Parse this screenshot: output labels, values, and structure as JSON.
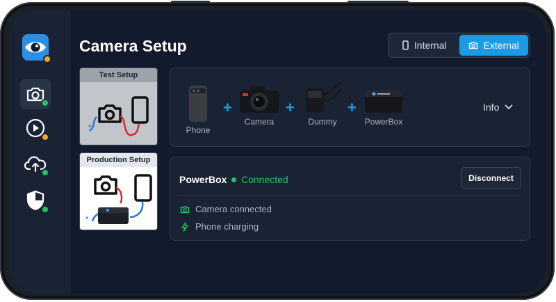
{
  "header": {
    "title": "Camera Setup"
  },
  "mode_toggle": {
    "options": [
      {
        "label": "Internal",
        "icon": "phone-icon",
        "selected": false
      },
      {
        "label": "External",
        "icon": "camera-icon",
        "selected": true
      }
    ]
  },
  "sidebar": {
    "logo_icon": "eye-logo-icon",
    "items": [
      {
        "icon": "camera-icon",
        "status": "green",
        "active": true
      },
      {
        "icon": "play-icon",
        "status": "orange",
        "active": false
      },
      {
        "icon": "cloud-upload-icon",
        "status": "green",
        "active": false
      },
      {
        "icon": "shield-icon",
        "status": "green",
        "active": false
      }
    ]
  },
  "setups": [
    {
      "label": "Test Setup"
    },
    {
      "label": "Production Setup"
    }
  ],
  "devices": [
    {
      "label": "Phone"
    },
    {
      "label": "Camera"
    },
    {
      "label": "Dummy"
    },
    {
      "label": "PowerBox"
    }
  ],
  "info_label": "Info",
  "powerbox": {
    "name": "PowerBox",
    "status": "Connected",
    "disconnect_label": "Disconnect",
    "rows": [
      {
        "icon": "camera-icon",
        "text": "Camera connected"
      },
      {
        "icon": "bolt-icon",
        "text": "Phone charging"
      }
    ]
  },
  "colors": {
    "accent": "#1a9be6",
    "success": "#22c55e",
    "warning": "#f5a524",
    "background": "#121b2e"
  }
}
